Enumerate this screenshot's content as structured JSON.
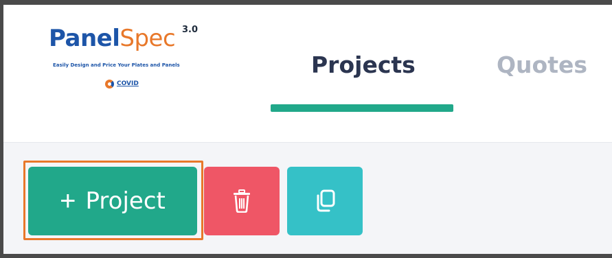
{
  "logo": {
    "word_panel": "Panel",
    "word_spec": "Spec",
    "version": "3.0",
    "tagline": "Easily Design and Price Your Plates and Panels",
    "badge": "COVID"
  },
  "tabs": [
    {
      "label": "Projects",
      "active": true
    },
    {
      "label": "Quotes",
      "active": false
    }
  ],
  "toolbar": {
    "add_project_plus": "+",
    "add_project_label": "Project",
    "delete_icon": "trash-icon",
    "copy_icon": "copy-icon"
  },
  "colors": {
    "accent": "#21a88a",
    "delete": "#ef5666",
    "copy": "#35c1c7",
    "highlight": "#e8782a",
    "tab_active": "#2b3550",
    "tab_inactive": "#aeb5c2"
  }
}
